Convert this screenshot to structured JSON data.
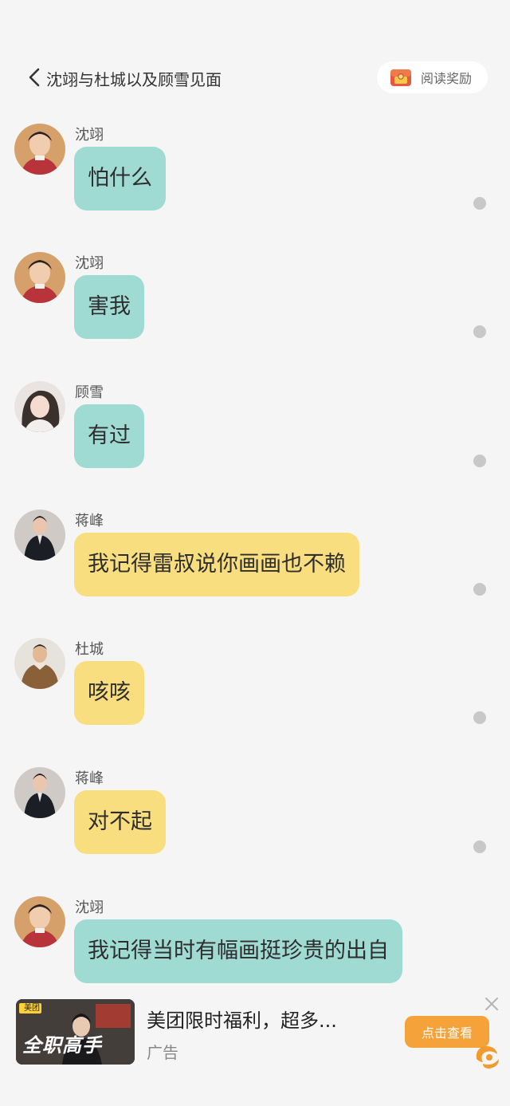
{
  "header": {
    "title": "沈翊与杜城以及顾雪见面",
    "reward_label": "阅读奖励"
  },
  "messages": [
    {
      "sender": "沈翊",
      "text": "怕什么",
      "color": "teal"
    },
    {
      "sender": "沈翊",
      "text": "害我",
      "color": "teal"
    },
    {
      "sender": "顾雪",
      "text": "有过",
      "color": "teal"
    },
    {
      "sender": "蒋峰",
      "text": "我记得雷叔说你画画也不赖",
      "color": "yellow"
    },
    {
      "sender": "杜城",
      "text": "咳咳",
      "color": "yellow"
    },
    {
      "sender": "蒋峰",
      "text": "对不起",
      "color": "yellow"
    },
    {
      "sender": "沈翊",
      "text": "我记得当时有幅画挺珍贵的出自",
      "color": "teal"
    }
  ],
  "ad": {
    "thumb_brand": "美团",
    "thumb_caption": "全职高手",
    "title": "美团限时福利，超多...",
    "label": "广告",
    "button": "点击查看"
  },
  "colors": {
    "teal_bubble": "#9fdad3",
    "yellow_bubble": "#f8de7e",
    "background": "#f5f5f5",
    "ad_button": "#f5a23a"
  }
}
